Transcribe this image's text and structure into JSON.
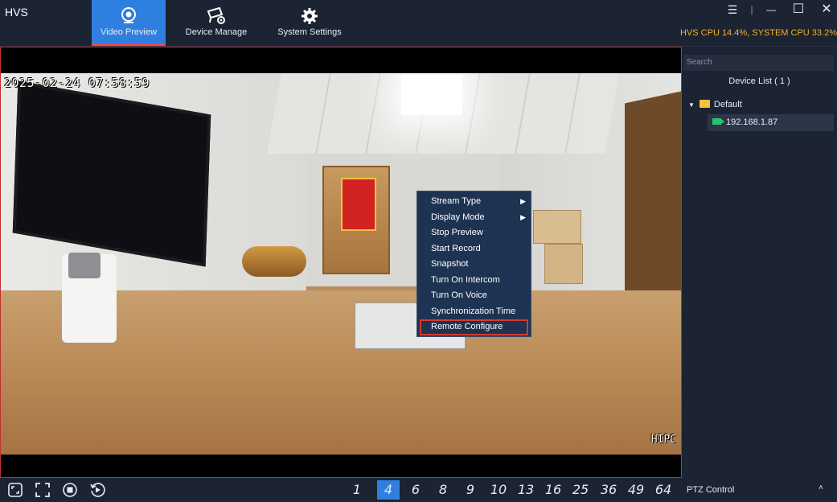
{
  "app": {
    "title": "HVS"
  },
  "tabs": [
    {
      "label": "Video Preview",
      "icon": "webcam-icon",
      "active": true
    },
    {
      "label": "Device Manage",
      "icon": "camera-gear-icon",
      "active": false
    },
    {
      "label": "System Settings",
      "icon": "gear-icon",
      "active": false
    }
  ],
  "status": {
    "cpu": "HVS CPU 14.4%, SYSTEM CPU 33.2%"
  },
  "window_controls": {
    "menu": "☰",
    "separator": "|",
    "minimize": "—",
    "maximize": "☐",
    "close": "✕"
  },
  "video": {
    "timestamp": "2025-02-24 07:58:59",
    "watermark": "HIPC"
  },
  "context_menu": {
    "items": [
      {
        "label": "Stream Type",
        "submenu": true
      },
      {
        "label": "Display Mode",
        "submenu": true
      },
      {
        "label": "Stop Preview",
        "submenu": false
      },
      {
        "label": "Start Record",
        "submenu": false
      },
      {
        "label": "Snapshot",
        "submenu": false
      },
      {
        "label": "Turn On Intercom",
        "submenu": false
      },
      {
        "label": "Turn On Voice",
        "submenu": false
      },
      {
        "label": "Synchronization Time",
        "submenu": false
      },
      {
        "label": "Remote Configure",
        "submenu": false,
        "highlighted": true
      }
    ],
    "submenu_arrow": "▶"
  },
  "sidebar": {
    "search_placeholder": "Search",
    "device_list_title": "Device List ( 1 )",
    "group": {
      "caret": "▼",
      "label": "Default"
    },
    "device": {
      "label": "192.168.1.87"
    }
  },
  "bottom": {
    "icons": [
      "fit-screen-icon",
      "fullscreen-icon",
      "stop-all-icon",
      "replay-icon"
    ],
    "splits": [
      "1",
      "4",
      "6",
      "8",
      "9",
      "10",
      "13",
      "16",
      "25",
      "36",
      "49",
      "64"
    ],
    "active_split": "4",
    "ptz_label": "PTZ Control",
    "ptz_caret": "˄"
  },
  "colors": {
    "accent": "#2f7fe0",
    "cpu_text": "#f5b021",
    "highlight_border": "#d63a2f",
    "menu_bg": "#1e3352",
    "device_icon": "#2ec26c",
    "folder": "#f2c23b"
  }
}
